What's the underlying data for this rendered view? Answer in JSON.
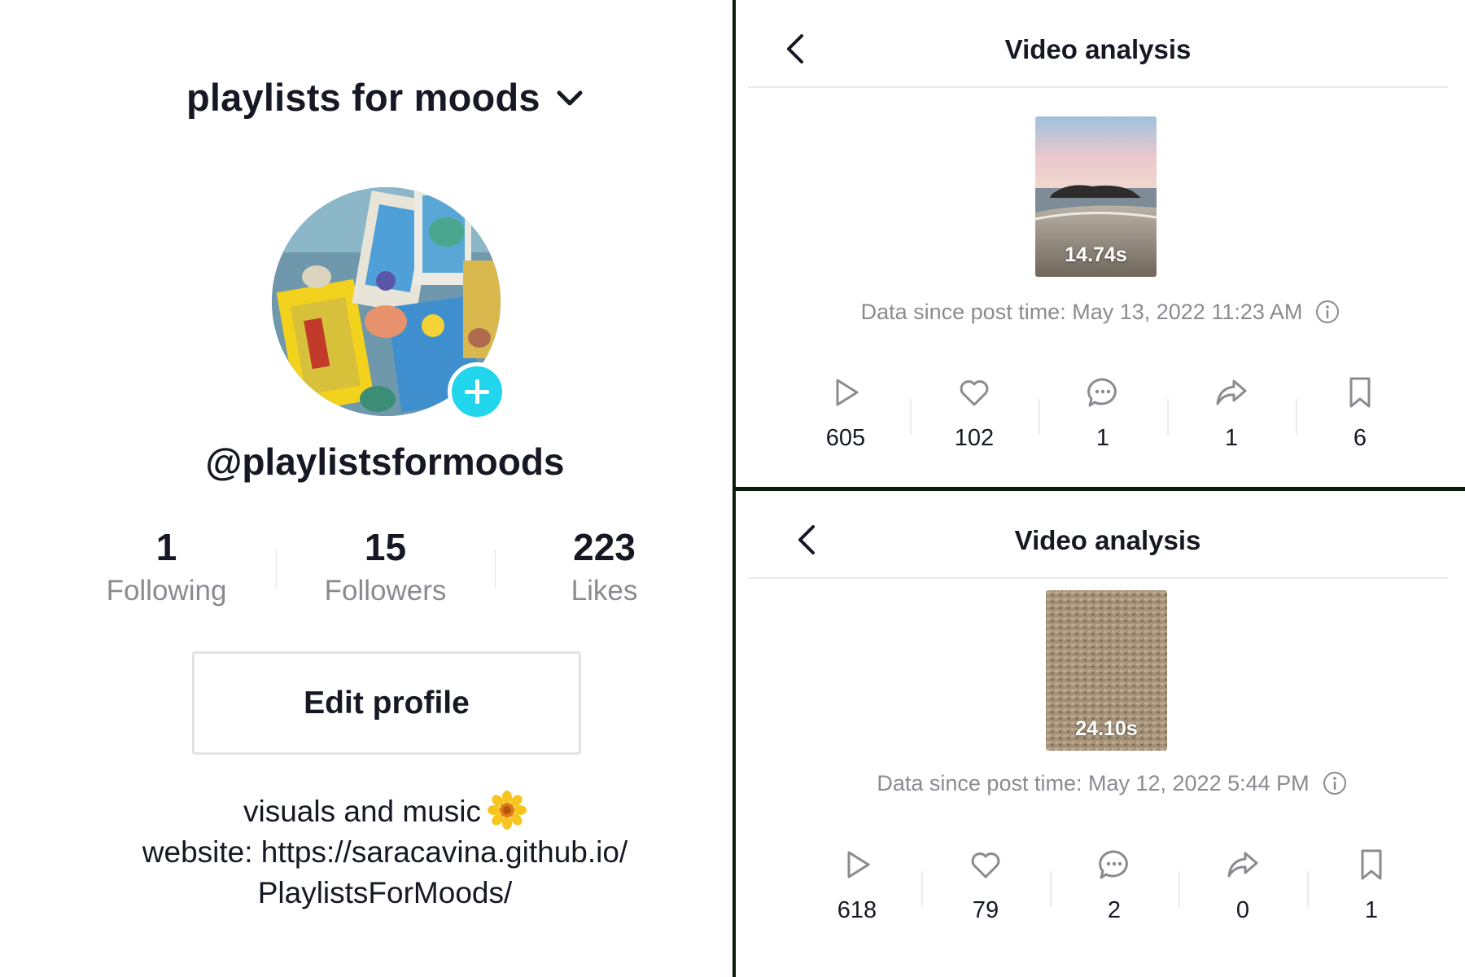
{
  "profile": {
    "title": "playlists for moods",
    "username": "@playlistsformoods",
    "stats": [
      {
        "value": "1",
        "label": "Following"
      },
      {
        "value": "15",
        "label": "Followers"
      },
      {
        "value": "223",
        "label": "Likes"
      }
    ],
    "edit_label": "Edit profile",
    "bio_line1": "visuals and music",
    "bio_line2": "website: https://saracavina.github.io/",
    "bio_line3": "PlaylistsForMoods/"
  },
  "analyses": [
    {
      "title": "Video analysis",
      "duration": "14.74s",
      "since": "Data since post time: May 13, 2022 11:23 AM",
      "metrics": {
        "plays": "605",
        "likes": "102",
        "comments": "1",
        "shares": "1",
        "saves": "6"
      }
    },
    {
      "title": "Video analysis",
      "duration": "24.10s",
      "since": "Data since post time: May 12, 2022 5:44 PM",
      "metrics": {
        "plays": "618",
        "likes": "79",
        "comments": "2",
        "shares": "0",
        "saves": "1"
      }
    }
  ],
  "colors": {
    "accent": "#20d5ec",
    "text": "#161823",
    "muted": "#8a8b91",
    "divider": "#0b1a0b"
  }
}
